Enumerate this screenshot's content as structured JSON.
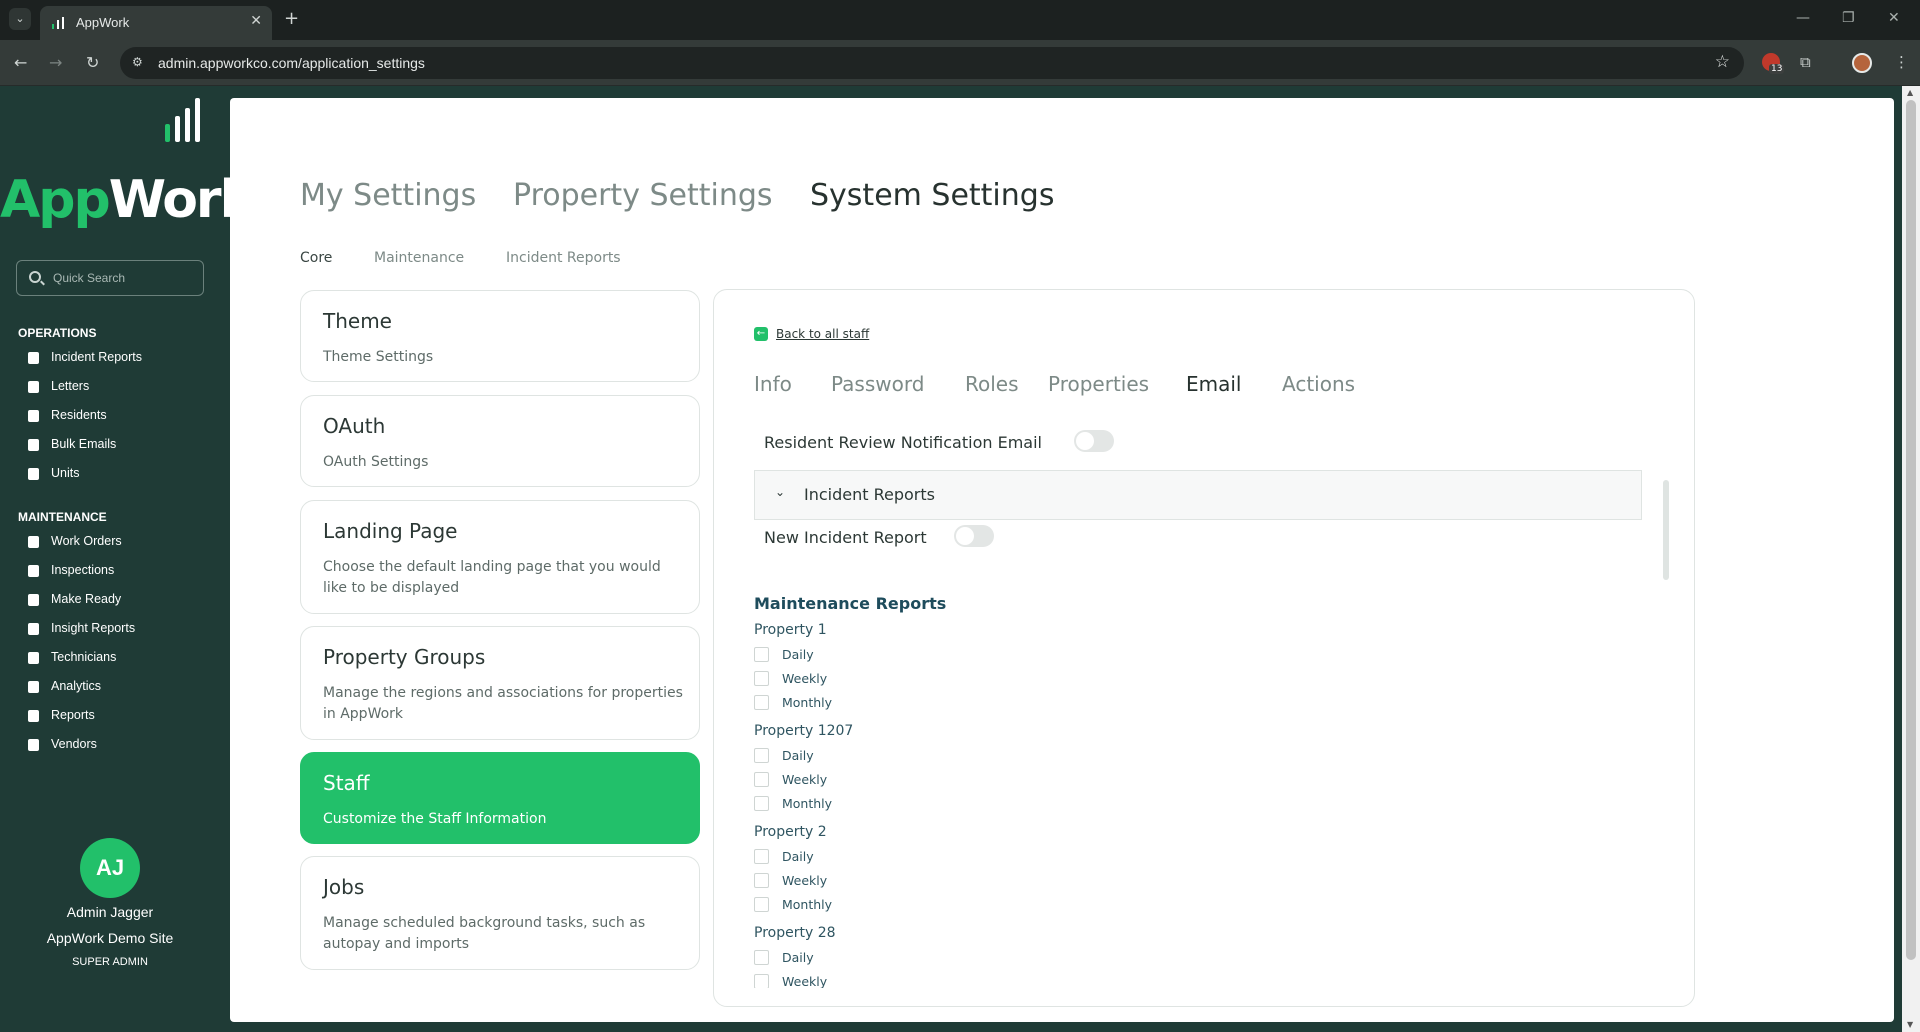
{
  "browser": {
    "tab_title": "AppWork",
    "url": "admin.appworkco.com/application_settings",
    "extension_badge": "13"
  },
  "sidebar": {
    "logo_prefix": "App",
    "logo_suffix": "Work",
    "search_placeholder": "Quick Search",
    "operations_heading": "OPERATIONS",
    "operations_items": [
      {
        "label": "Incident Reports",
        "icon": "document-icon"
      },
      {
        "label": "Letters",
        "icon": "document-icon"
      },
      {
        "label": "Residents",
        "icon": "people-icon"
      },
      {
        "label": "Bulk Emails",
        "icon": "mailbox-icon"
      },
      {
        "label": "Units",
        "icon": "home-icon"
      }
    ],
    "maintenance_heading": "MAINTENANCE",
    "maintenance_items": [
      {
        "label": "Work Orders",
        "icon": "wrench-icon"
      },
      {
        "label": "Inspections",
        "icon": "document-icon"
      },
      {
        "label": "Make Ready",
        "icon": "paint-icon"
      },
      {
        "label": "Insight Reports",
        "icon": "document-icon"
      },
      {
        "label": "Technicians",
        "icon": "hardhat-icon"
      },
      {
        "label": "Analytics",
        "icon": "chart-icon"
      },
      {
        "label": "Reports",
        "icon": "document-icon"
      },
      {
        "label": "Vendors",
        "icon": "person-icon"
      }
    ],
    "user": {
      "initials": "AJ",
      "name": "Admin Jagger",
      "site": "AppWork Demo Site",
      "role": "SUPER ADMIN"
    }
  },
  "settings": {
    "top_tabs": [
      "My Settings",
      "Property Settings",
      "System Settings"
    ],
    "active_top_tab": "System Settings",
    "sub_tabs": [
      "Core",
      "Maintenance",
      "Incident Reports"
    ],
    "active_sub_tab": "Core",
    "cards": [
      {
        "title": "Theme",
        "desc": "Theme Settings"
      },
      {
        "title": "OAuth",
        "desc": "OAuth Settings"
      },
      {
        "title": "Landing Page",
        "desc": "Choose the default landing page that you would like to be displayed"
      },
      {
        "title": "Property Groups",
        "desc": "Manage the regions and associations for properties in AppWork"
      },
      {
        "title": "Staff",
        "desc": "Customize the Staff Information"
      },
      {
        "title": "Jobs",
        "desc": "Manage scheduled background tasks, such as autopay and imports"
      }
    ],
    "active_card": "Staff"
  },
  "detail": {
    "back_link": "Back to all staff",
    "tabs": [
      "Info",
      "Password",
      "Roles",
      "Properties",
      "Email",
      "Actions"
    ],
    "active_tab": "Email",
    "resident_review_label": "Resident Review Notification Email",
    "accordion_title": "Incident Reports",
    "new_incident_label": "New Incident Report",
    "maintenance_heading": "Maintenance Reports",
    "properties": [
      {
        "name": "Property 1",
        "options": [
          "Daily",
          "Weekly",
          "Monthly"
        ]
      },
      {
        "name": "Property 1207",
        "options": [
          "Daily",
          "Weekly",
          "Monthly"
        ]
      },
      {
        "name": "Property 2",
        "options": [
          "Daily",
          "Weekly",
          "Monthly"
        ]
      },
      {
        "name": "Property 28",
        "options": [
          "Daily",
          "Weekly"
        ]
      }
    ]
  },
  "colors": {
    "sidebar_bg": "#1f3b36",
    "accent_green": "#22c06a",
    "heading_teal": "#1e4c5c"
  }
}
